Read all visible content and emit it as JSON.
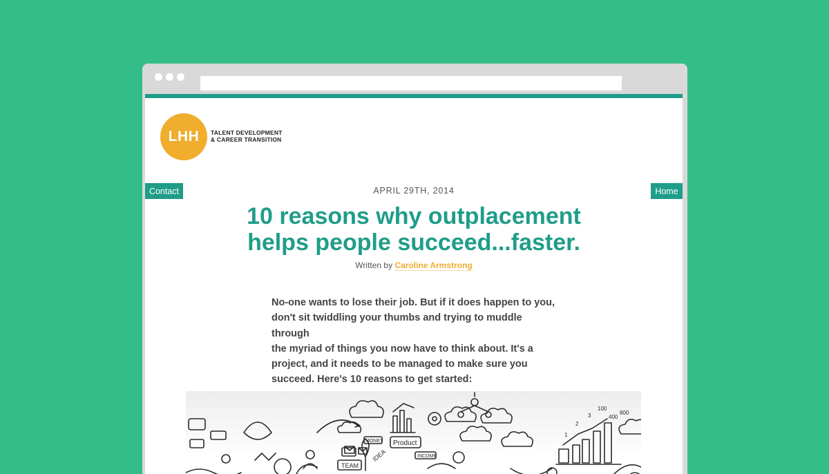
{
  "browser": {
    "address": ""
  },
  "site": {
    "logo_text": "LHH",
    "tagline_line1": "TALENT DEVELOPMENT",
    "tagline_line2": "& CAREER TRANSITION"
  },
  "nav": {
    "contact_label": "Contact",
    "home_label": "Home"
  },
  "article": {
    "date": "APRIL 29TH, 2014",
    "title_line1": "10 reasons why outplacement",
    "title_line2": "helps people succeed...faster.",
    "byline_prefix": "Written by",
    "author": "Caroline Armstrong",
    "intro_lines": [
      "No-one wants to lose their job. But if it does happen to you,",
      "don't sit twiddling your thumbs and trying to muddle through",
      "the myriad of things you now have to think about. It's a",
      "project, and it needs to be managed to make sure you",
      "succeed. Here's 10 reasons to get started:"
    ]
  },
  "hero_image": {
    "labels": {
      "money": "MONEY",
      "product": "Product",
      "idea": "IDEA",
      "income": "INCOME",
      "team": "TEAM",
      "n1": "1",
      "n2": "2",
      "n3": "3",
      "n100": "100",
      "n400": "400",
      "n800": "800"
    }
  },
  "colors": {
    "background": "#35bd89",
    "accent": "#1f9d89",
    "brand_orange": "#f0ad2e"
  }
}
